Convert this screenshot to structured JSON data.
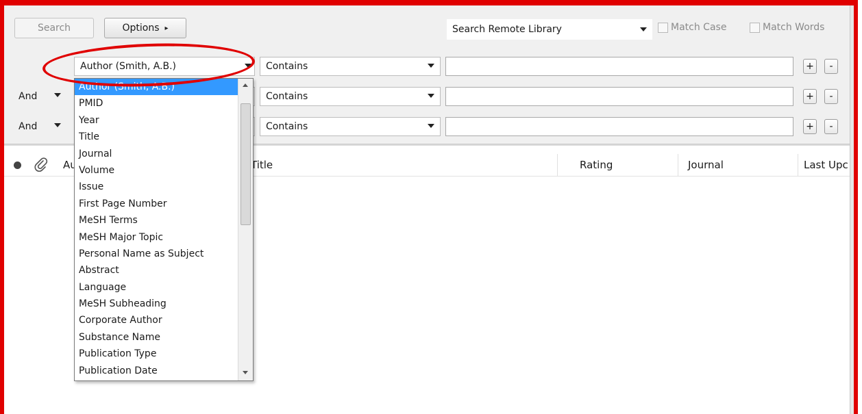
{
  "toolbar": {
    "search_label": "Search",
    "options_label": "Options",
    "options_arrow": "▸",
    "library_select": "Search Remote Library",
    "match_case_label": "Match Case",
    "match_words_label": "Match Words"
  },
  "search_rows": [
    {
      "connector": "",
      "field": "Author (Smith, A.B.)",
      "operator": "Contains",
      "value": ""
    },
    {
      "connector": "And",
      "field": "",
      "operator": "Contains",
      "value": ""
    },
    {
      "connector": "And",
      "field": "",
      "operator": "Contains",
      "value": ""
    }
  ],
  "row_buttons": {
    "add": "+",
    "remove": "-"
  },
  "field_dropdown": {
    "items": [
      "Author (Smith, A.B.)",
      "PMID",
      "Year",
      "Title",
      "Journal",
      "Volume",
      "Issue",
      "First Page Number",
      "MeSH Terms",
      "MeSH Major Topic",
      "Personal Name as Subject",
      "Abstract",
      "Language",
      "MeSH Subheading",
      "Corporate Author",
      "Substance Name",
      "Publication Type",
      "Publication Date"
    ],
    "selected_index": 0
  },
  "results_table": {
    "columns": [
      "Au",
      "Title",
      "Rating",
      "Journal",
      "Last Upc"
    ]
  },
  "colors": {
    "highlight": "#e00000",
    "selection": "#3399ff",
    "panel_bg": "#f0f0f0"
  }
}
